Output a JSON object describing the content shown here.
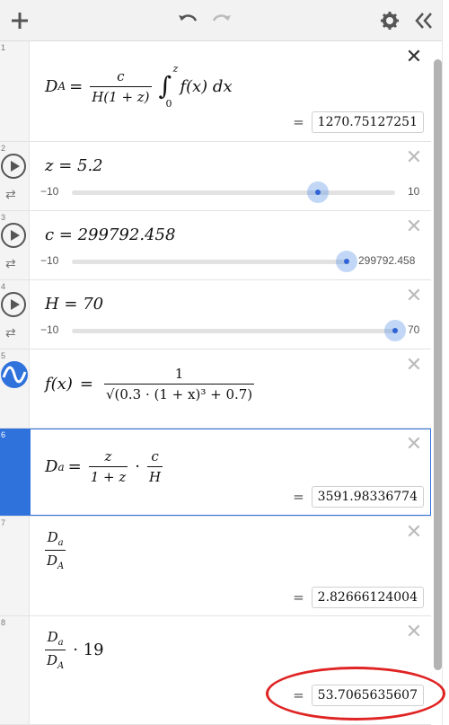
{
  "toolbar": {
    "add": "add-icon",
    "undo": "undo-icon",
    "redo": "redo-icon",
    "settings": "gear-icon",
    "collapse": "collapse-icon"
  },
  "expressions": [
    {
      "index": "1",
      "lhs": "D",
      "lhs_sub": "A",
      "eq": "=",
      "frac_num": "c",
      "frac_den": "H(1 + z)",
      "integral": "∫",
      "int_upper": "z",
      "int_lower": "0",
      "integrand": "f(x) dx",
      "result": "1270.75127251"
    },
    {
      "index": "2",
      "formula": "z = 5.2",
      "min": "−10",
      "max": "10",
      "value_fraction": 0.76
    },
    {
      "index": "3",
      "formula": "c = 299792.458",
      "min": "−10",
      "max": "299792.458",
      "value_fraction": 1.0
    },
    {
      "index": "4",
      "formula": "H = 70",
      "min": "−10",
      "max": "70",
      "value_fraction": 1.0
    },
    {
      "index": "5",
      "lhs": "f(x)",
      "eq": "=",
      "num": "1",
      "den": "√(0.3 · (1 + x)³ + 0.7)"
    },
    {
      "index": "6",
      "lhs": "D",
      "lhs_sub": "a",
      "eq": "=",
      "frac1_num": "z",
      "frac1_den": "1 + z",
      "dot": "·",
      "frac2_num": "c",
      "frac2_den": "H",
      "result": "3591.98336774"
    },
    {
      "index": "7",
      "num": "D",
      "num_sub": "a",
      "den": "D",
      "den_sub": "A",
      "result": "2.82666124004"
    },
    {
      "index": "8",
      "num": "D",
      "num_sub": "a",
      "den": "D",
      "den_sub": "A",
      "tail": "· 19",
      "result": "53.7065635607"
    }
  ],
  "equals_sign": "=",
  "accent_color": "#2f72dc",
  "highlight_color": "#e02424"
}
